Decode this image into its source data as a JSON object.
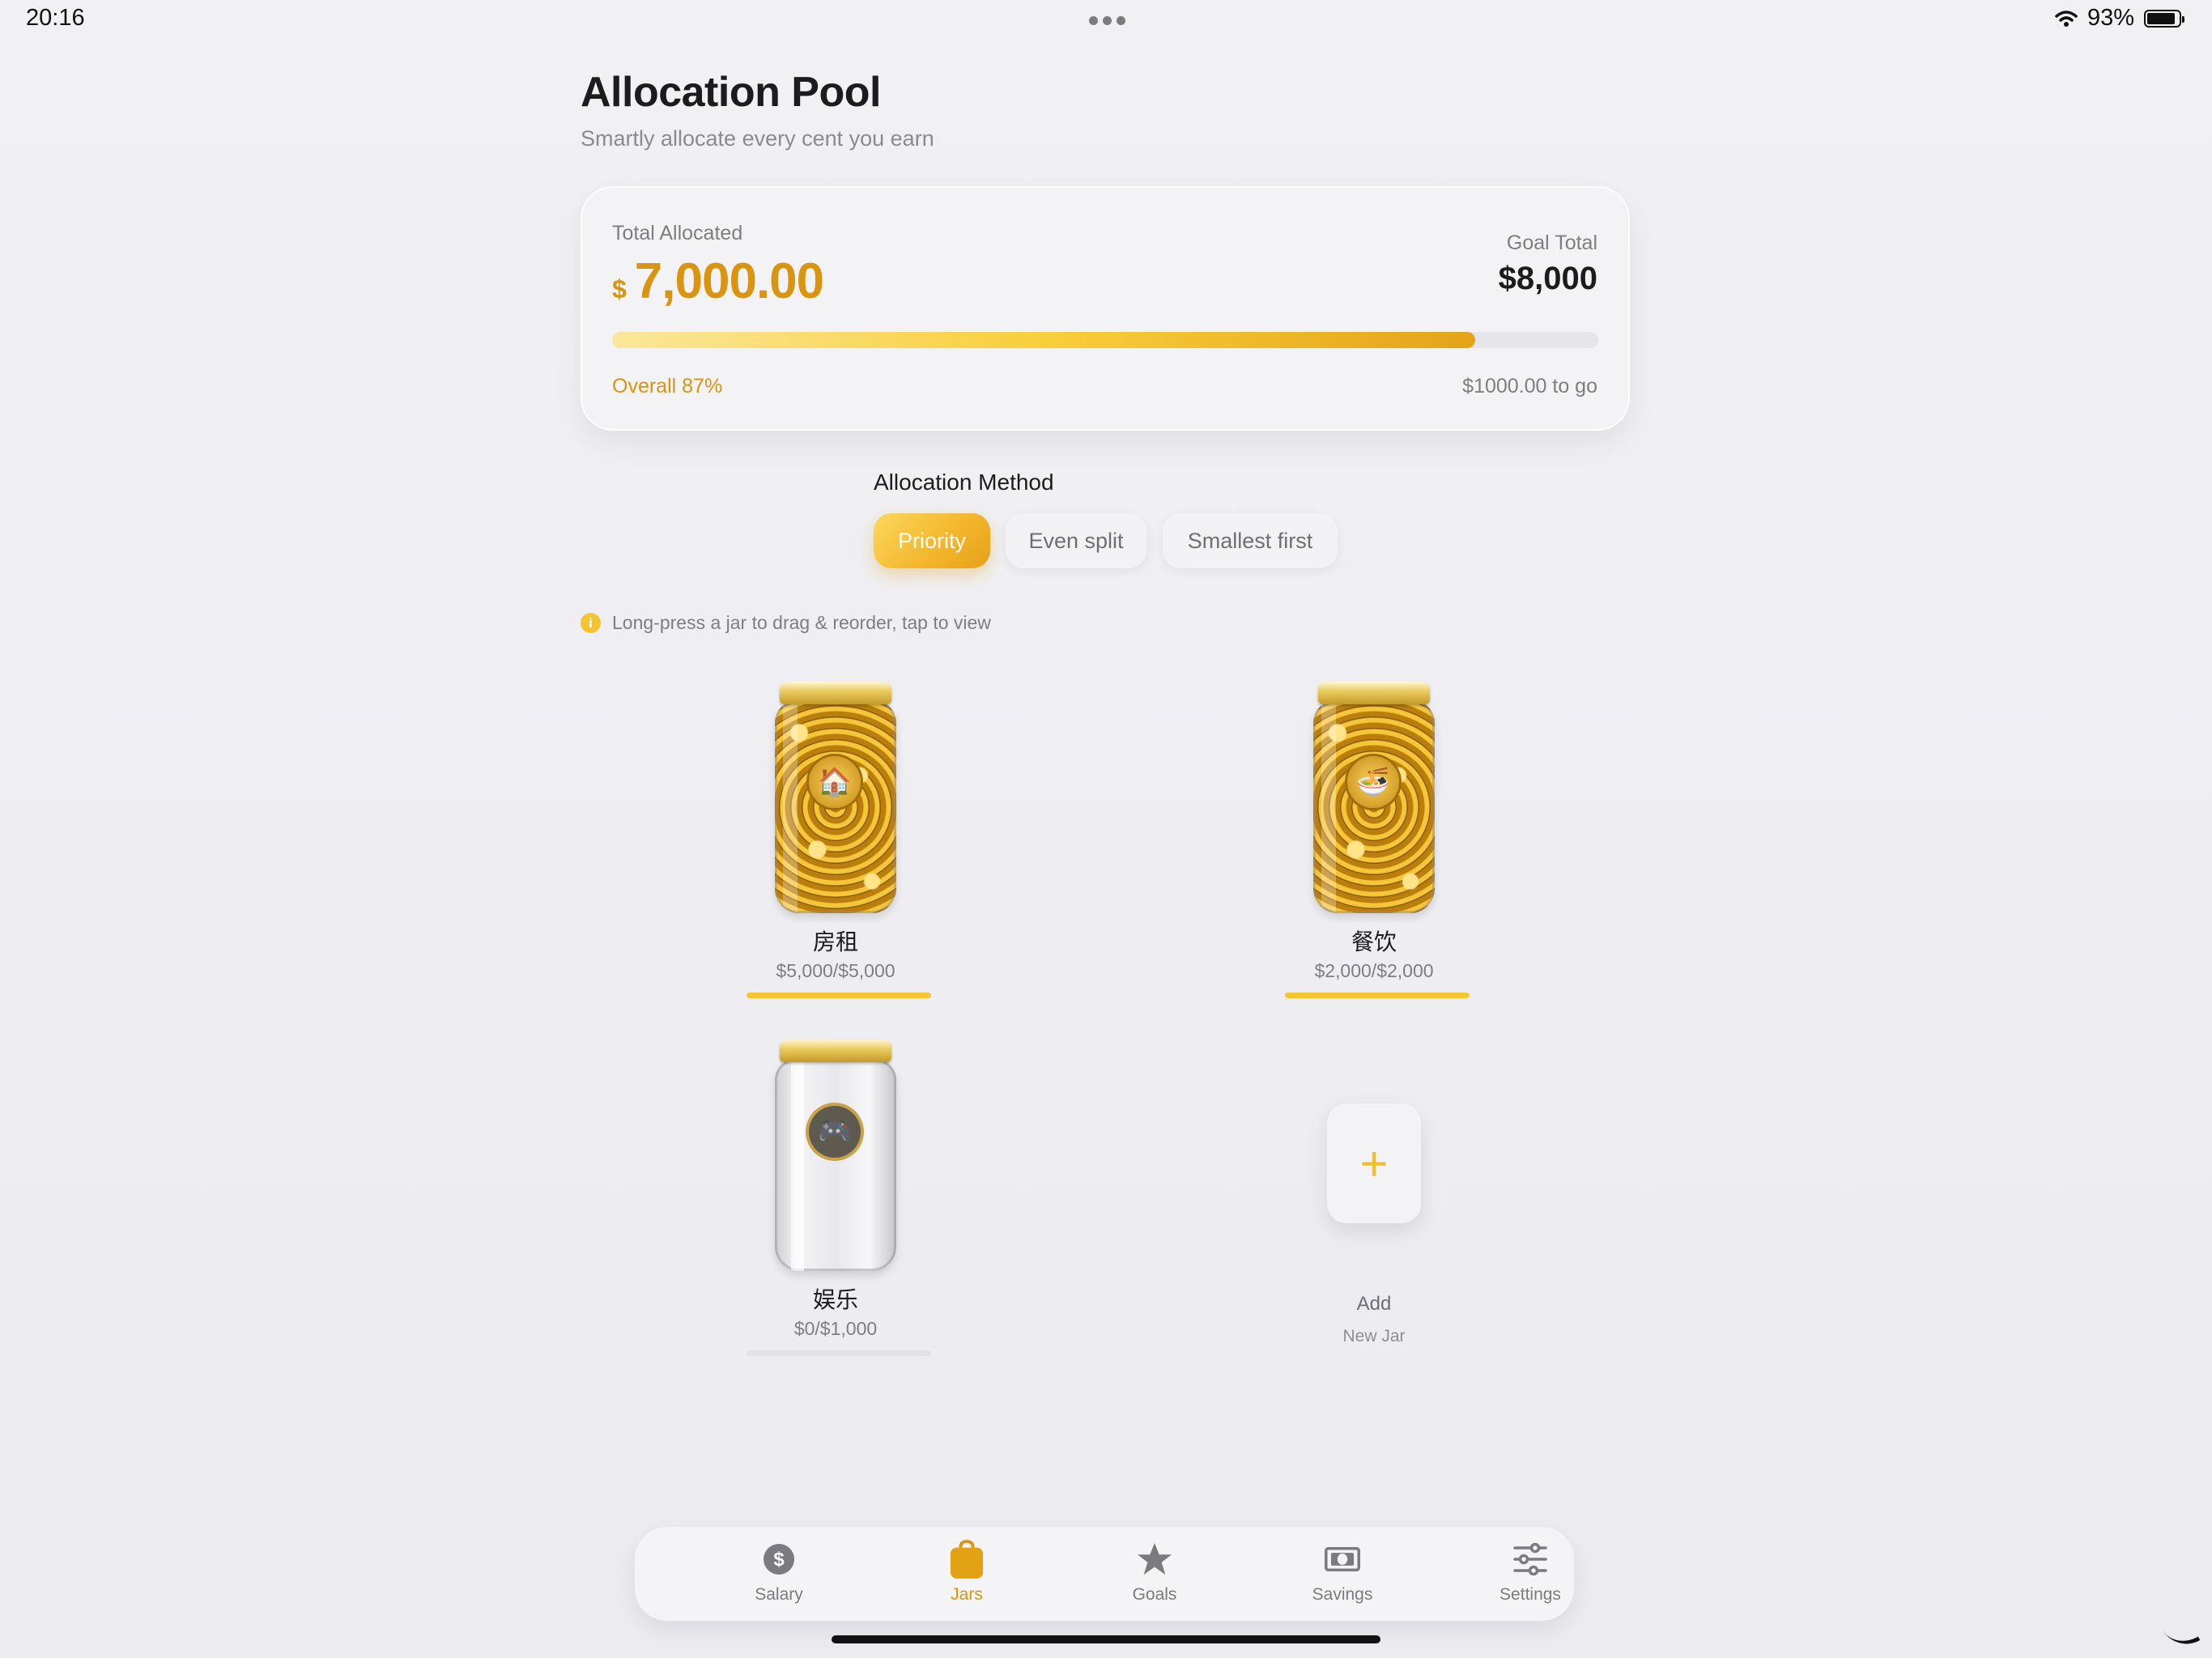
{
  "status_bar": {
    "time": "20:16",
    "battery": "93%"
  },
  "header": {
    "title": "Allocation Pool",
    "subtitle": "Smartly allocate every cent you earn"
  },
  "summary": {
    "total_label": "Total Allocated",
    "currency": "$",
    "total_value": "7,000.00",
    "goal_label": "Goal Total",
    "goal_value": "$8,000",
    "progress_fraction": 0.875,
    "overall_label": "Overall 87%",
    "to_go_label": "$1000.00 to go"
  },
  "allocation_method": {
    "title": "Allocation Method",
    "options": [
      "Priority",
      "Even split",
      "Smallest first"
    ],
    "selected": "Priority"
  },
  "hint": "Long-press a jar to drag & reorder, tap to view",
  "jars": [
    {
      "name": "房租",
      "amount": "$5,000/$5,000",
      "icon": "🏠",
      "progress": 1.0,
      "fill": "full"
    },
    {
      "name": "餐饮",
      "amount": "$2,000/$2,000",
      "icon": "🍜",
      "progress": 1.0,
      "fill": "full"
    },
    {
      "name": "娱乐",
      "amount": "$0/$1,000",
      "icon": "🎮",
      "progress": 0.0,
      "fill": "empty"
    }
  ],
  "add_jar": {
    "icon": "+",
    "label": "Add",
    "sublabel": "New Jar"
  },
  "tabs": [
    {
      "label": "Salary",
      "icon": "dollar-circle-icon"
    },
    {
      "label": "Jars",
      "icon": "jar-bag-icon",
      "active": true
    },
    {
      "label": "Goals",
      "icon": "star-icon"
    },
    {
      "label": "Savings",
      "icon": "banknote-icon"
    },
    {
      "label": "Settings",
      "icon": "sliders-icon"
    }
  ],
  "colors": {
    "accent": "#d99410",
    "accent_light": "#f5c531",
    "background": "#efeff3"
  }
}
